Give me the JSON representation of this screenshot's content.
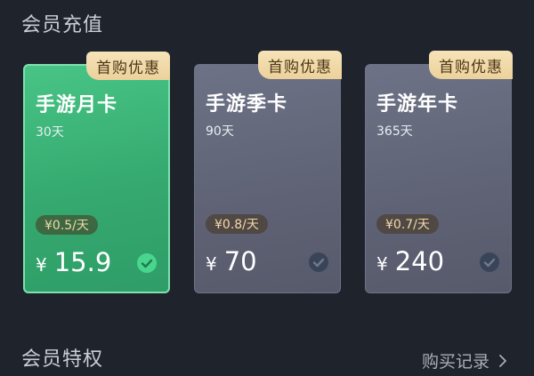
{
  "sections": {
    "recharge_title": "会员充值",
    "privilege_title": "会员特权"
  },
  "purchase_history": {
    "label": "购买记录"
  },
  "cards": [
    {
      "badge": "首购优惠",
      "name": "手游月卡",
      "duration": "30天",
      "daily_price": "¥0.5/天",
      "currency": "¥",
      "price": "15.9",
      "selected": true
    },
    {
      "badge": "首购优惠",
      "name": "手游季卡",
      "duration": "90天",
      "daily_price": "¥0.8/天",
      "currency": "¥",
      "price": "70",
      "selected": false
    },
    {
      "badge": "首购优惠",
      "name": "手游年卡",
      "duration": "365天",
      "daily_price": "¥0.7/天",
      "currency": "¥",
      "price": "240",
      "selected": false
    }
  ],
  "colors": {
    "background": "#1f242c",
    "selected_card": "#3bb275",
    "unselected_card": "#5e6274",
    "badge": "#ecd19b",
    "check_selected": "#48d68e",
    "check_unselected": "#3a4458"
  }
}
